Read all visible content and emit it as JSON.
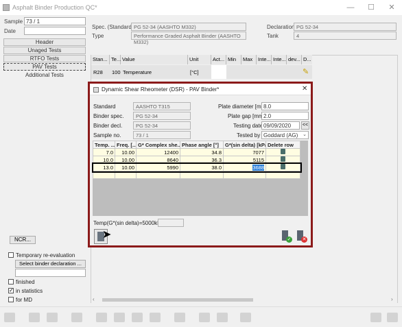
{
  "window": {
    "title": "Asphalt Binder Production QC*",
    "controls": {
      "minimize": "—",
      "maximize": "☐",
      "close": "✕"
    }
  },
  "left": {
    "sample_label": "Sample",
    "sample_value": "73 / 1",
    "date_label": "Date",
    "date_value": "",
    "sections": [
      "Header",
      "Unaged Tests",
      "RTFO Tests",
      "PAV Tests",
      "Additional Tests"
    ],
    "selected_section": "PAV Tests",
    "ncr_button": "NCR...",
    "temp_reeval_label": "Temporary re-evaluation",
    "select_binder_button": "Select binder declaration ...",
    "binder_decl_value": "",
    "checks": [
      {
        "label": "finished",
        "checked": false
      },
      {
        "label": "in statistics",
        "checked": true
      },
      {
        "label": "for MD",
        "checked": false
      }
    ]
  },
  "header": {
    "spec_label": "Spec. (Standard)",
    "spec_value": "PG 52-34 (AASHTO M332)",
    "type_label": "Type",
    "type_value": "Performance Graded Asphalt Binder (AASHTO M332)",
    "declaration_label": "Declaration",
    "declaration_value": "PG 52-34",
    "tank_label": "Tank",
    "tank_value": "4"
  },
  "main_grid": {
    "columns": [
      "Stan...",
      "Te...",
      "Value",
      "Unit",
      "Act...",
      "Min",
      "Max",
      "Inte...",
      "Inte...",
      "dev...",
      "D..."
    ],
    "rows": [
      [
        "R28",
        "100",
        "Temperature",
        "[°C]",
        "",
        "",
        "",
        "",
        "",
        "",
        ""
      ]
    ]
  },
  "dialog": {
    "title": "Dynamic Shear Rheometer (DSR) - PAV Binder*",
    "close": "✕",
    "standard_label": "Standard",
    "standard_value": "AASHTO T315",
    "binder_spec_label": "Binder spec.",
    "binder_spec_value": "PG 52-34",
    "binder_decl_label": "Binder decl.",
    "binder_decl_value": "PG 52-34",
    "sample_no_label": "Sample no.",
    "sample_no_value": "73 / 1",
    "plate_diameter_label": "Plate diameter [mm]",
    "plate_diameter_value": "8.0",
    "plate_gap_label": "Plate gap [mm]",
    "plate_gap_value": "2.0",
    "testing_date_label": "Testing date",
    "testing_date_value": "09/09/2020",
    "date_nav": "<<",
    "tested_by_label": "Tested by",
    "tested_by_value": "Goddard (AG)",
    "grid_columns": [
      "Temp. ...",
      "Freq. [...",
      "G* Complex she...",
      "Phase angle [°]",
      "G*(sin delta) [kPa]",
      "Delete row"
    ],
    "grid_rows": [
      [
        "7.0",
        "10.00",
        "12400",
        "34.8",
        "7077"
      ],
      [
        "10.0",
        "10.00",
        "8640",
        "36.3",
        "5115"
      ],
      [
        "13.0",
        "10.00",
        "5990",
        "38.0",
        "3688"
      ]
    ],
    "result_label": "Temp(G*(sin delta)=5000kPa)",
    "result_value": ""
  }
}
